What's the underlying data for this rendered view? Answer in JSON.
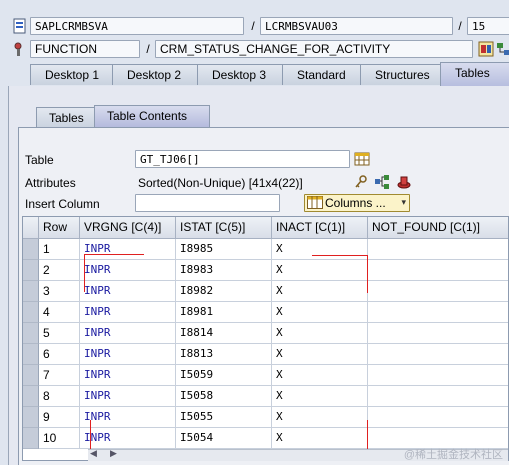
{
  "header": {
    "program": "SAPLCRMBSVA",
    "include": "LCRMBSVAU03",
    "line_no": "15",
    "type": "FUNCTION",
    "name": "CRM_STATUS_CHANGE_FOR_ACTIVITY"
  },
  "tabs": [
    {
      "label": "Desktop 1"
    },
    {
      "label": "Desktop 2"
    },
    {
      "label": "Desktop 3"
    },
    {
      "label": "Standard"
    },
    {
      "label": "Structures"
    },
    {
      "label": "Tables"
    }
  ],
  "subtabs": [
    {
      "label": "Tables"
    },
    {
      "label": "Table Contents"
    }
  ],
  "form": {
    "table_label": "Table",
    "table_value": "GT_TJ06[]",
    "attributes_label": "Attributes",
    "attributes_value": "Sorted(Non-Unique) [41x4(22)]",
    "insert_column_label": "Insert Column",
    "insert_column_value": "",
    "columns_button": "Columns ..."
  },
  "grid": {
    "headers": [
      "Row",
      "VRGNG [C(4)]",
      "ISTAT [C(5)]",
      "INACT [C(1)]",
      "NOT_FOUND [C(1)]"
    ],
    "rows": [
      [
        "1",
        "INPR",
        "I8985",
        "X",
        ""
      ],
      [
        "2",
        "INPR",
        "I8983",
        "X",
        ""
      ],
      [
        "3",
        "INPR",
        "I8982",
        "X",
        ""
      ],
      [
        "4",
        "INPR",
        "I8981",
        "X",
        ""
      ],
      [
        "5",
        "INPR",
        "I8814",
        "X",
        ""
      ],
      [
        "6",
        "INPR",
        "I8813",
        "X",
        ""
      ],
      [
        "7",
        "INPR",
        "I5059",
        "X",
        ""
      ],
      [
        "8",
        "INPR",
        "I5058",
        "X",
        ""
      ],
      [
        "9",
        "INPR",
        "I5055",
        "X",
        ""
      ],
      [
        "10",
        "INPR",
        "I5054",
        "X",
        ""
      ]
    ]
  },
  "watermark": "@稀土掘金技术社区",
  "colors": {
    "annotation": "#e02020",
    "link_text": "#1a1aa0"
  }
}
